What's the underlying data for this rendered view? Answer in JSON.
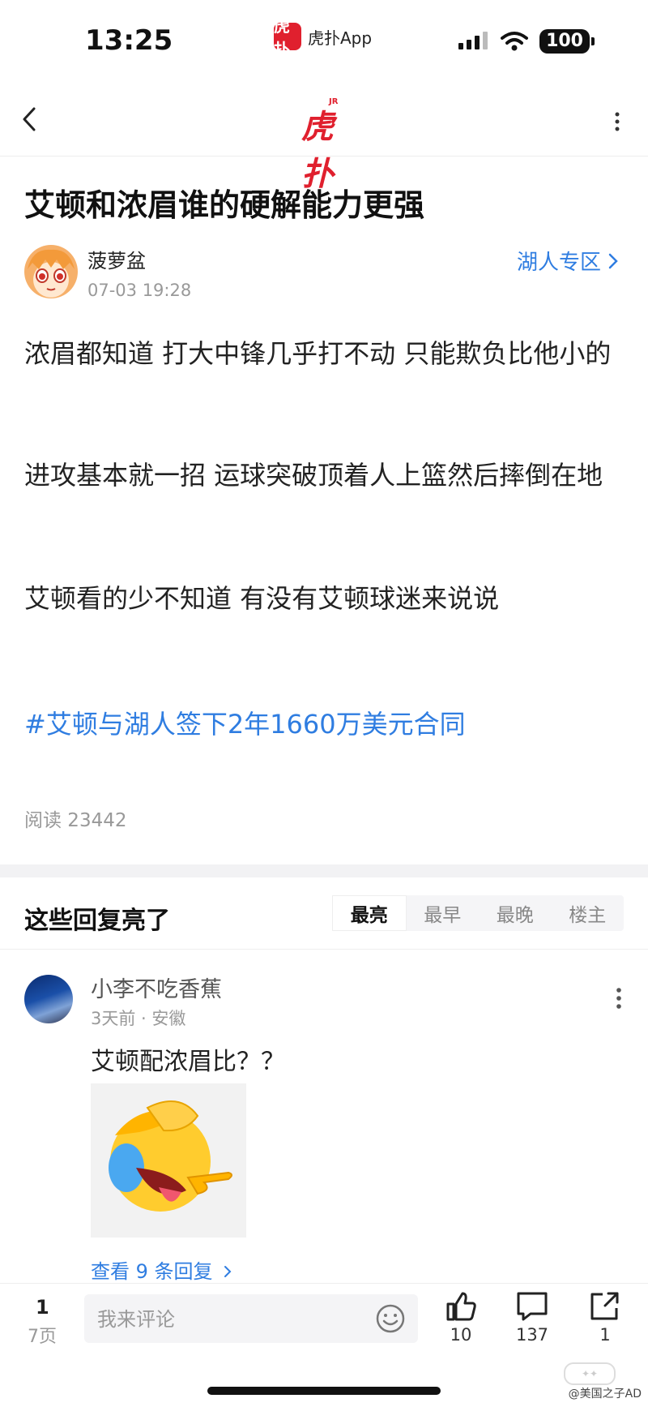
{
  "status_bar": {
    "time": "13:25",
    "app_name": "虎扑App",
    "app_badge": "虎扑",
    "battery": "100"
  },
  "nav": {
    "logo_text": "虎扑",
    "logo_sub": "JR"
  },
  "post": {
    "title": "艾顿和浓眉谁的硬解能力更强",
    "author": "菠萝盆",
    "time": "07-03 19:28",
    "zone": "湖人专区",
    "paragraphs": [
      "浓眉都知道 打大中锋几乎打不动 只能欺负比他小的",
      "进攻基本就一招 运球突破顶着人上篮然后摔倒在地",
      "艾顿看的少不知道 有没有艾顿球迷来说说"
    ],
    "topic": "#艾顿与湖人签下2年1660万美元合同",
    "reads": "阅读 23442"
  },
  "comments": {
    "header": "这些回复亮了",
    "sort_tabs": [
      "最亮",
      "最早",
      "最晚",
      "楼主"
    ],
    "sort_active": "最亮",
    "items": [
      {
        "user": "小李不吃香蕉",
        "meta": "3天前 · 安徽",
        "text": "艾顿配浓眉比？？",
        "view_replies": "查看 9 条回复"
      }
    ]
  },
  "bottom_bar": {
    "page_current": "1",
    "page_total": "7页",
    "comment_placeholder": "我来评论",
    "likes": "10",
    "comments": "137",
    "shares": "1"
  },
  "watermark": {
    "text": "@美国之子AD"
  },
  "colors": {
    "accent_blue": "#2f7de1",
    "brand_red": "#e0202e"
  }
}
